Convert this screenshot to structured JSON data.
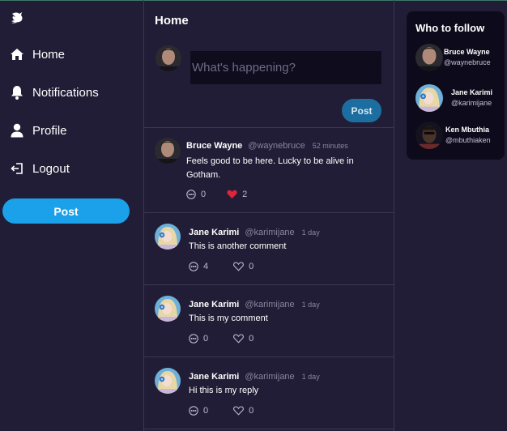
{
  "colors": {
    "background": "#221d36",
    "accent": "#1ba0ea",
    "panel": "#0d0b1b",
    "like": "#e0243a"
  },
  "sidebar": {
    "logo_icon": "bird-logo-icon",
    "items": [
      {
        "label": "Home",
        "icon": "home-icon"
      },
      {
        "label": "Notifications",
        "icon": "bell-icon"
      },
      {
        "label": "Profile",
        "icon": "user-icon"
      },
      {
        "label": "Logout",
        "icon": "logout-icon"
      }
    ],
    "post_label": "Post"
  },
  "main": {
    "title": "Home",
    "composer": {
      "placeholder": "What's happening?",
      "post_label": "Post"
    },
    "posts": [
      {
        "name": "Bruce Wayne",
        "handle": "@waynebruce",
        "time": "52 minutes",
        "text": "Feels good to be here. Lucky to be alive in Gotham.",
        "comments": "0",
        "likes": "2",
        "liked": true
      },
      {
        "name": "Jane Karimi",
        "handle": "@karimijane",
        "time": "1 day",
        "text": "This is another comment",
        "comments": "4",
        "likes": "0",
        "liked": false
      },
      {
        "name": "Jane Karimi",
        "handle": "@karimijane",
        "time": "1 day",
        "text": "This is my comment",
        "comments": "0",
        "likes": "0",
        "liked": false
      },
      {
        "name": "Jane Karimi",
        "handle": "@karimijane",
        "time": "1 day",
        "text": "Hi this is my reply",
        "comments": "0",
        "likes": "0",
        "liked": false
      }
    ]
  },
  "who_to_follow": {
    "title": "Who to follow",
    "users": [
      {
        "name": "Bruce Wayne",
        "handle": "@waynebruce"
      },
      {
        "name": "Jane Karimi",
        "handle": "@karimijane"
      },
      {
        "name": "Ken Mbuthia",
        "handle": "@mbuthiaken"
      }
    ]
  }
}
